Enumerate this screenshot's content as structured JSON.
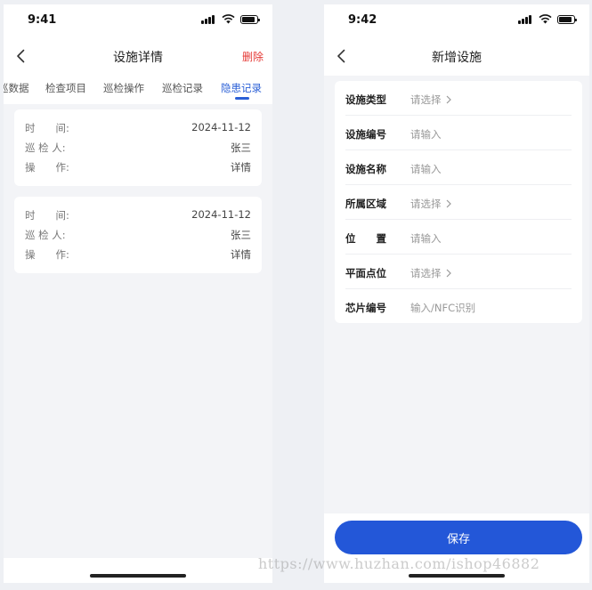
{
  "left_screen": {
    "status_time": "9:41",
    "nav": {
      "title": "设施详情",
      "action": "删除"
    },
    "tabs": [
      {
        "label": "巡数据",
        "active": false
      },
      {
        "label": "检查项目",
        "active": false
      },
      {
        "label": "巡检操作",
        "active": false
      },
      {
        "label": "巡检记录",
        "active": false
      },
      {
        "label": "隐患记录",
        "active": true
      }
    ],
    "records": [
      {
        "rows": [
          {
            "label": "时　　间:",
            "value": "2024-11-12"
          },
          {
            "label": "巡 检 人:",
            "value": "张三"
          },
          {
            "label": "操　　作:",
            "value": "详情"
          }
        ]
      },
      {
        "rows": [
          {
            "label": "时　　间:",
            "value": "2024-11-12"
          },
          {
            "label": "巡 检 人:",
            "value": "张三"
          },
          {
            "label": "操　　作:",
            "value": "详情"
          }
        ]
      }
    ]
  },
  "right_screen": {
    "status_time": "9:42",
    "nav": {
      "title": "新增设施"
    },
    "form": [
      {
        "label": "设施类型",
        "value": "请选择",
        "chevron": true
      },
      {
        "label": "设施编号",
        "value": "请输入",
        "chevron": false
      },
      {
        "label": "设施名称",
        "value": "请输入",
        "chevron": false
      },
      {
        "label": "所属区域",
        "value": "请选择",
        "chevron": true
      },
      {
        "label": "位　　置",
        "value": "请输入",
        "chevron": false
      },
      {
        "label": "平面点位",
        "value": "请选择",
        "chevron": true
      },
      {
        "label": "芯片编号",
        "value": "输入/NFC识别",
        "chevron": false
      }
    ],
    "save_label": "保存"
  },
  "watermark": "https://www.huzhan.com/ishop46882",
  "colors": {
    "accent": "#2357d8",
    "danger": "#e53935",
    "background": "#f3f4f7"
  }
}
